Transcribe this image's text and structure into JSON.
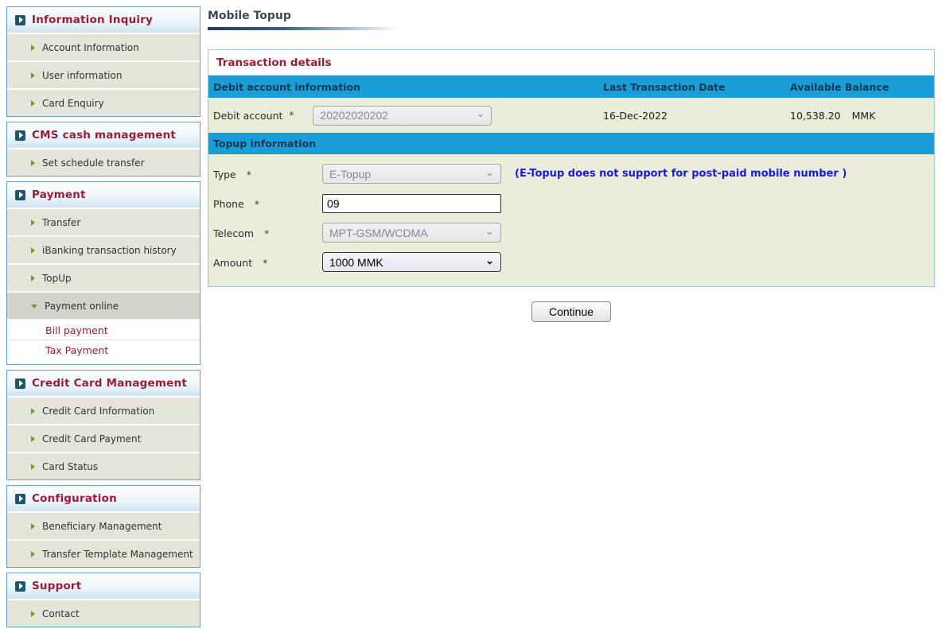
{
  "page": {
    "title": "Mobile Topup"
  },
  "colors": {
    "accent_blue": "#1b9ed8",
    "maroon": "#9c1c33",
    "notice_blue": "#1a1adf",
    "sidebar_item_bg": "#e4e4d9",
    "form_bg": "#e9edd9",
    "panel_border": "#9ec5e2",
    "olive_arrow": "#7a9b21",
    "teal_icon": "#1b586e"
  },
  "sidebar": {
    "sections": [
      {
        "title": "Information Inquiry",
        "items": [
          {
            "label": "Account Information"
          },
          {
            "label": "User information"
          },
          {
            "label": "Card Enquiry"
          }
        ]
      },
      {
        "title": "CMS cash management",
        "items": [
          {
            "label": "Set schedule transfer"
          }
        ]
      },
      {
        "title": "Payment",
        "items": [
          {
            "label": "Transfer"
          },
          {
            "label": "iBanking transaction history"
          },
          {
            "label": "TopUp"
          },
          {
            "label": "Payment online",
            "state": "expanded"
          }
        ],
        "subitems": [
          {
            "label": "Bill payment"
          },
          {
            "label": "Tax Payment"
          }
        ]
      },
      {
        "title": "Credit Card Management",
        "items": [
          {
            "label": "Credit Card Information"
          },
          {
            "label": "Credit Card Payment"
          },
          {
            "label": "Card Status"
          }
        ]
      },
      {
        "title": "Configuration",
        "items": [
          {
            "label": "Beneficiary Management"
          },
          {
            "label": "Transfer Template Management"
          }
        ]
      },
      {
        "title": "Support",
        "items": [
          {
            "label": "Contact"
          }
        ]
      }
    ]
  },
  "main": {
    "panel_title": "Transaction details",
    "debit_header": {
      "col1": "Debit account information",
      "col2": "Last Transaction Date",
      "col3": "Available Balance"
    },
    "debit_row": {
      "label": "Debit account",
      "required": "*",
      "account": "20202020202",
      "last_date": "16-Dec-2022",
      "balance": "10,538.20",
      "currency": "MMK"
    },
    "topup_header": "Topup information",
    "form": {
      "type": {
        "label": "Type",
        "required": "*",
        "value": "E-Topup",
        "note": "(E-Topup does not support for post-paid mobile number )"
      },
      "phone": {
        "label": "Phone",
        "required": "*",
        "value": "09"
      },
      "telecom": {
        "label": "Telecom",
        "required": "*",
        "value": "MPT-GSM/WCDMA"
      },
      "amount": {
        "label": "Amount",
        "required": "*",
        "value": "1000 MMK"
      }
    },
    "continue_label": "Continue",
    "chevron": "⌄"
  }
}
